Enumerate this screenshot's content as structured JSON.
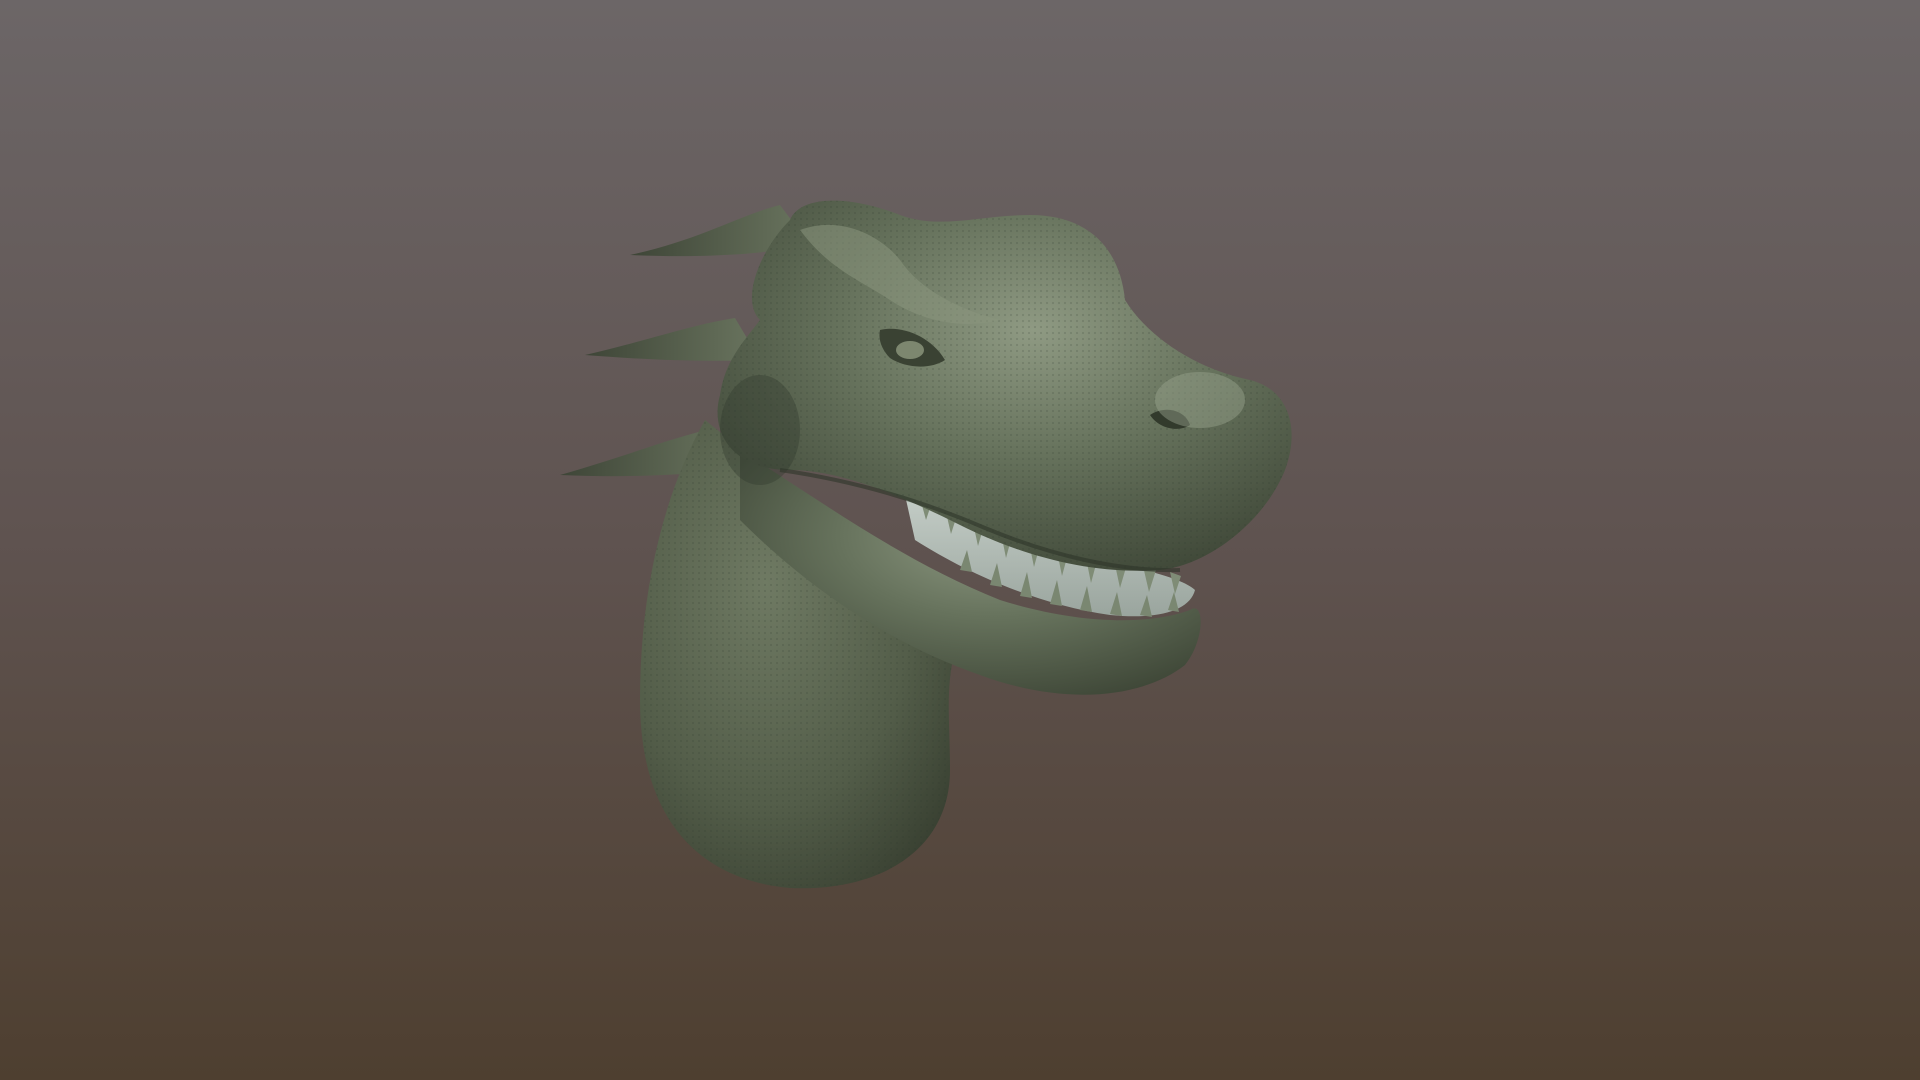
{
  "scene": {
    "subject": "dragon-head-sculpt",
    "background": {
      "top_color": "#6c6667",
      "mid_color": "#5f5350",
      "bottom_color": "#4e3f30"
    },
    "model": {
      "base_color": "#5f6a55",
      "highlight_color": "#8f9a83",
      "shadow_color": "#3a4233",
      "teeth_color": "#8e9b86",
      "mouth_interior_color": "#b7c1bb"
    }
  }
}
